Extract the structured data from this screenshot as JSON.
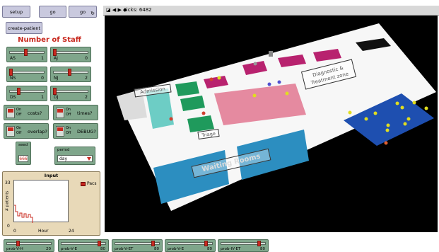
{
  "toolbar": {
    "setup_label": "setup",
    "go_once_label": "go",
    "go_forever_label": "go",
    "forever_icon": "↻",
    "create_patient_label": "create-patient"
  },
  "staff": {
    "title": "Number of Staff",
    "sliders": [
      {
        "label": "AS",
        "value": "1"
      },
      {
        "label": "AJ",
        "value": "0"
      },
      {
        "label": "NS",
        "value": "0"
      },
      {
        "label": "NJ",
        "value": "2"
      },
      {
        "label": "DS",
        "value": "1"
      },
      {
        "label": "DJ",
        "value": "2"
      }
    ]
  },
  "switches": [
    {
      "state": "On\nOff",
      "name": "costs?"
    },
    {
      "state": "On\nOff",
      "name": "times?"
    },
    {
      "state": "On\nOff",
      "name": "overlap?"
    },
    {
      "state": "On\nOff",
      "name": "DEBUG?"
    }
  ],
  "seed": {
    "label": "seed",
    "value": "666"
  },
  "period": {
    "label": "period",
    "value": "day"
  },
  "plot": {
    "title": "Input",
    "ylabel": "# patients",
    "xlabel": "Hour",
    "ymax": "33",
    "ymin": "0",
    "xmin": "0",
    "xmax": "24",
    "legend": "Pacs",
    "legend_color": "#c8281e"
  },
  "bottom_sliders": [
    {
      "label": "prob-V-H",
      "value": "20",
      "fraction": 0.2
    },
    {
      "label": "prob-V-E",
      "value": "80",
      "fraction": 0.8
    },
    {
      "label": "prob-V-ET",
      "value": "80",
      "fraction": 0.8
    },
    {
      "label": "prob-V-E",
      "value": "80",
      "fraction": 0.8
    },
    {
      "label": "prob-IV-ET",
      "value": "80",
      "fraction": 0.8
    }
  ],
  "view": {
    "ticks_text": "ticks: 6482",
    "controls": "◪ ◀ ▶ ◆"
  },
  "world_labels": {
    "admission": "Admission",
    "diagnostic": "Diagnostic &\nTreatment zone",
    "waiting": "Waiting Rooms",
    "triage": "Triage"
  },
  "colors": {
    "button": "#c9c9de",
    "widget_green": "#7fa68b",
    "accent_red": "#c8281e",
    "teal": "#6dcdc5",
    "green": "#1f9a5c",
    "magenta": "#b8226f",
    "pink": "#e58aa0",
    "blue": "#2c8ec0",
    "navy": "#1e4fb0"
  }
}
